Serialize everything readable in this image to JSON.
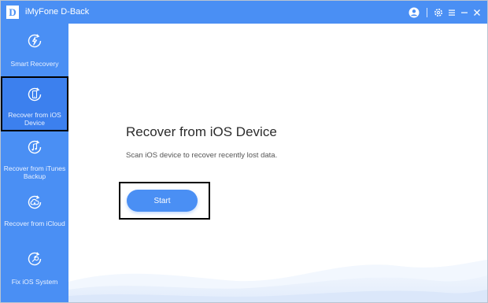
{
  "app": {
    "logo_letter": "D",
    "title": "iMyFone D-Back",
    "accent_color": "#4a8ff4"
  },
  "titlebar": {
    "icons": [
      "account-icon",
      "settings-icon",
      "menu-icon",
      "minimize-icon",
      "close-icon"
    ]
  },
  "sidebar": {
    "items": [
      {
        "label": "Smart Recovery",
        "icon": "lightning-recover-icon",
        "active": false
      },
      {
        "label": "Recover from iOS Device",
        "icon": "phone-recover-icon",
        "active": true
      },
      {
        "label": "Recover from iTunes Backup",
        "icon": "music-recover-icon",
        "active": false
      },
      {
        "label": "Recover from iCloud",
        "icon": "cloud-recover-icon",
        "active": false
      },
      {
        "label": "Fix iOS System",
        "icon": "wrench-icon",
        "active": false
      }
    ]
  },
  "main": {
    "title": "Recover from iOS Device",
    "description": "Scan iOS device to recover recently lost data.",
    "start_label": "Start"
  }
}
